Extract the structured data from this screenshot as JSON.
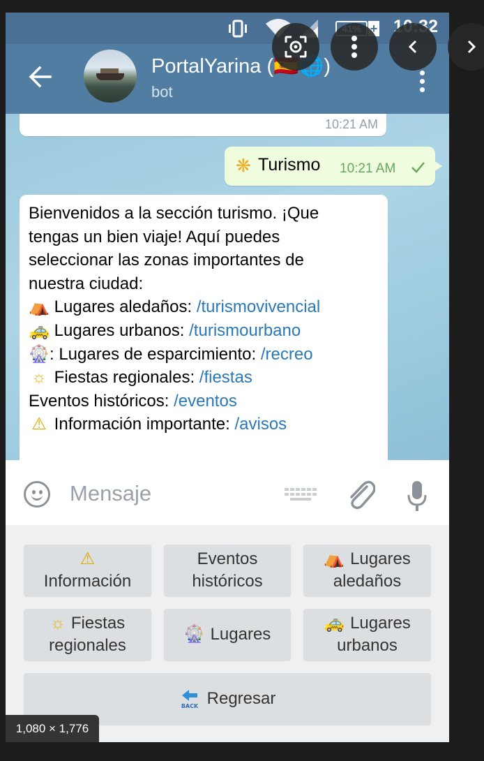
{
  "status_bar": {
    "battery": "41%",
    "time": "10:32"
  },
  "header": {
    "title": "PortalYarina (🇪🇸🌐)",
    "subtitle": "bot"
  },
  "messages": {
    "previous_time": "10:21 AM",
    "outgoing": {
      "emoji": "❋",
      "text": "Turismo",
      "time": "10:21 AM"
    },
    "incoming": {
      "intro_lines": [
        "Bienvenidos a la sección turismo. ¡Que",
        "tengas un bien viaje! Aquí puedes",
        "seleccionar las zonas importantes de",
        "nuestra ciudad:"
      ],
      "items": [
        {
          "emoji": "⛺",
          "label": "Lugares aledaños: ",
          "link": "/turismovivencial"
        },
        {
          "emoji": "🚕",
          "label": "Lugares urbanos: ",
          "link": "/turismourbano"
        },
        {
          "emoji": "🎡",
          "label": ": Lugares de esparcimiento: ",
          "link": "/recreo"
        },
        {
          "emoji": "☼",
          "label": "Fiestas regionales: ",
          "link": "/fiestas"
        },
        {
          "emoji": "",
          "label": "Eventos históricos: ",
          "link": "/eventos"
        },
        {
          "emoji": "⚠",
          "label": "Información importante: ",
          "link": "/avisos"
        }
      ]
    }
  },
  "input": {
    "placeholder": "Mensaje"
  },
  "keyboard": {
    "buttons": [
      {
        "emoji": "⚠",
        "lines": [
          "",
          "Información"
        ]
      },
      {
        "emoji": "",
        "lines": [
          "Eventos",
          "históricos"
        ]
      },
      {
        "emoji": "⛺",
        "lines": [
          "Lugares",
          "aledaños"
        ]
      },
      {
        "emoji": "☼",
        "lines": [
          "Fiestas",
          "regionales"
        ]
      },
      {
        "emoji": "🎡",
        "lines": [
          "Lugares"
        ]
      },
      {
        "emoji": "🚕",
        "lines": [
          "Lugares",
          "urbanos"
        ]
      }
    ],
    "back_button": {
      "label": "Regresar",
      "icon_text": "BACK"
    }
  },
  "viewer": {
    "dimensions": "1,080 × 1,776"
  },
  "colors": {
    "header": "#527da3",
    "status_bar": "#4b7095",
    "link": "#2a78b9",
    "outgoing_bubble": "#effdde",
    "time_out": "#64a85e"
  }
}
